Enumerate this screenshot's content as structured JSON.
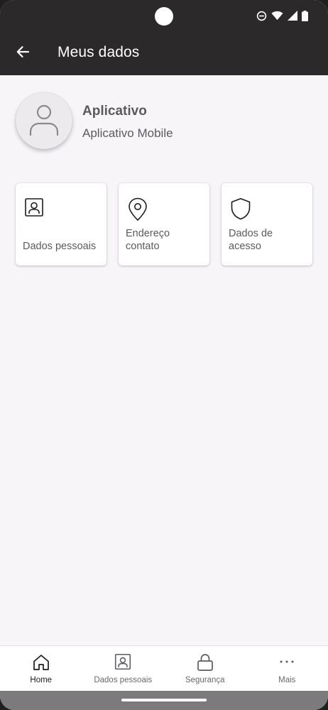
{
  "app_bar": {
    "title": "Meus dados",
    "back_icon": "arrow-left-icon"
  },
  "status_bar": {
    "icons": [
      "do-not-disturb-icon",
      "wifi-icon",
      "signal-icon",
      "battery-icon"
    ]
  },
  "profile": {
    "name": "Aplicativo",
    "subtitle": "Aplicativo Mobile",
    "avatar_icon": "user-icon"
  },
  "cards": [
    {
      "label": "Dados pessoais",
      "icon": "id-badge-icon"
    },
    {
      "label": "Endereço contato",
      "icon": "map-pin-icon"
    },
    {
      "label": "Dados de acesso",
      "icon": "shield-icon"
    }
  ],
  "bottom_nav": {
    "items": [
      {
        "label": "Home",
        "icon": "home-icon",
        "active": true
      },
      {
        "label": "Dados pessoais",
        "icon": "id-badge-icon",
        "active": false
      },
      {
        "label": "Segurança",
        "icon": "lock-icon",
        "active": false
      },
      {
        "label": "Mais",
        "icon": "more-horizontal-icon",
        "active": false
      }
    ]
  },
  "colors": {
    "app_bar": "#2b2929",
    "background": "#f7f5f8",
    "text": "#5d5a5e",
    "card": "#ffffff"
  }
}
